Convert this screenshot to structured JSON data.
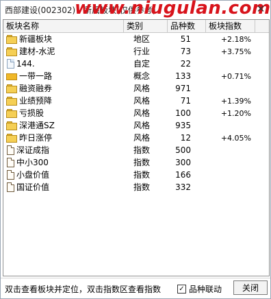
{
  "window": {
    "title": "西部建设(002302) - 所属板块(仅供参考)",
    "watermark": "www.niugulan.com",
    "close_glyph": "✕"
  },
  "table": {
    "columns": [
      "板块名称",
      "类别",
      "品种数",
      "板块指数"
    ],
    "rows": [
      {
        "name": "新疆板块",
        "type": "地区",
        "count": "51",
        "pct": "+2.18%",
        "icon": "folder-icon"
      },
      {
        "name": "建材-水泥",
        "type": "行业",
        "count": "73",
        "pct": "+3.75%",
        "icon": "folder-icon"
      },
      {
        "name": "144.",
        "type": "自定",
        "count": "22",
        "pct": "",
        "icon": "file-icon"
      },
      {
        "name": "一带一路",
        "type": "概念",
        "count": "133",
        "pct": "+0.71%",
        "icon": "folder-flat-icon"
      },
      {
        "name": "融资融券",
        "type": "风格",
        "count": "971",
        "pct": "",
        "icon": "folder-icon"
      },
      {
        "name": "业绩预降",
        "type": "风格",
        "count": "71",
        "pct": "+1.39%",
        "icon": "folder-icon"
      },
      {
        "name": "亏损股",
        "type": "风格",
        "count": "100",
        "pct": "+1.20%",
        "icon": "folder-icon"
      },
      {
        "name": "深港通SZ",
        "type": "风格",
        "count": "935",
        "pct": "",
        "icon": "folder-icon"
      },
      {
        "name": "昨日涨停",
        "type": "风格",
        "count": "12",
        "pct": "+4.05%",
        "icon": "folder-icon"
      },
      {
        "name": "深证成指",
        "type": "指数",
        "count": "500",
        "pct": "",
        "icon": "doc-icon"
      },
      {
        "name": "中小300",
        "type": "指数",
        "count": "300",
        "pct": "",
        "icon": "doc-icon"
      },
      {
        "name": "小盘价值",
        "type": "指数",
        "count": "166",
        "pct": "",
        "icon": "doc-icon"
      },
      {
        "name": "国证价值",
        "type": "指数",
        "count": "332",
        "pct": "",
        "icon": "doc-icon"
      }
    ]
  },
  "status": {
    "hint": "双击查看板块并定位，双击指数区查看指数",
    "checkbox_label": "品种联动",
    "checkbox_checked": true,
    "check_glyph": "✓",
    "close_button": "关闭"
  }
}
